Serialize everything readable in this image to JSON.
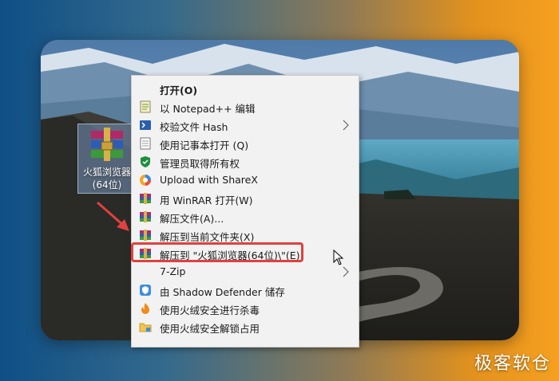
{
  "desktop": {
    "file": {
      "label": "火狐浏览器\n(64位)",
      "icon": "winrar-archive-icon"
    }
  },
  "context_menu": {
    "items": [
      {
        "label": "打开(O)",
        "icon": "none",
        "bold": true
      },
      {
        "label": "以 Notepad++ 编辑",
        "icon": "notepadpp-icon"
      },
      {
        "label": "校验文件 Hash",
        "icon": "powershell-icon",
        "submenu": true
      },
      {
        "label": "使用记事本打开 (Q)",
        "icon": "notepad-icon"
      },
      {
        "label": "管理员取得所有权",
        "icon": "shield-icon"
      },
      {
        "label": "Upload with ShareX",
        "icon": "sharex-icon"
      },
      {
        "label": "用 WinRAR 打开(W)",
        "icon": "winrar-icon"
      },
      {
        "label": "解压文件(A)...",
        "icon": "winrar-icon"
      },
      {
        "label": "解压到当前文件夹(X)",
        "icon": "winrar-icon"
      },
      {
        "label": "解压到 \"火狐浏览器(64位)\\\"(E)",
        "icon": "winrar-icon",
        "highlighted": true
      },
      {
        "label": "7-Zip",
        "icon": "none",
        "submenu": true
      },
      {
        "label": "由 Shadow Defender 储存",
        "icon": "shadow-defender-icon"
      },
      {
        "label": "使用火绒安全进行杀毒",
        "icon": "huorong-icon"
      },
      {
        "label": "使用火绒安全解锁占用",
        "icon": "folder-unlock-icon"
      }
    ]
  },
  "highlight_color": "#e04040",
  "watermark": "极客软仓"
}
